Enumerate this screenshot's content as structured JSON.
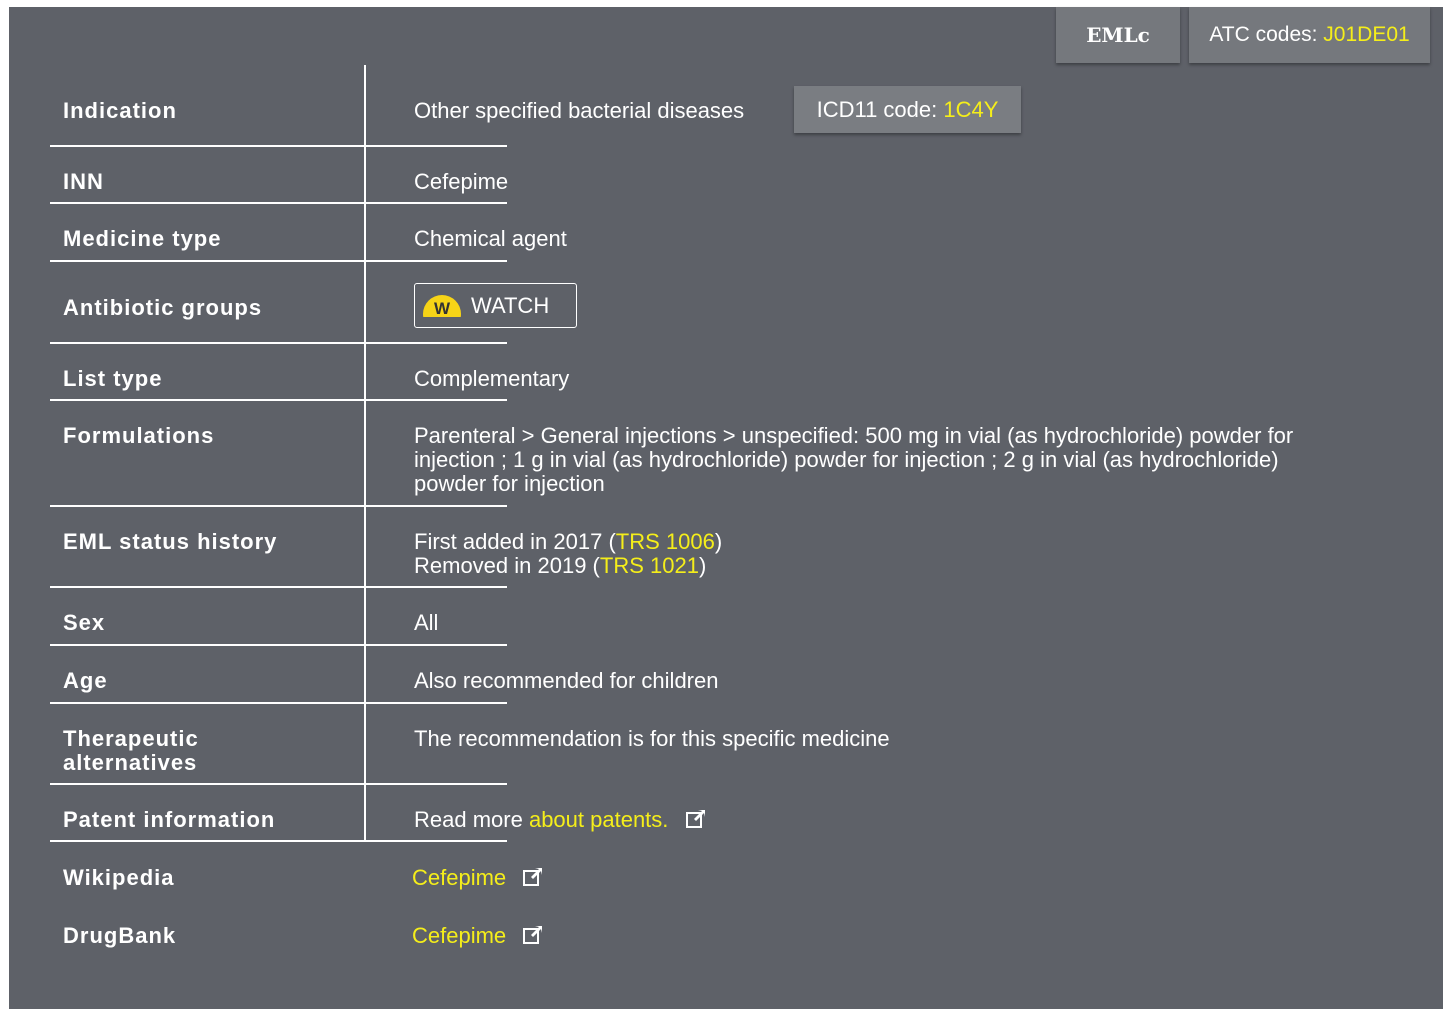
{
  "tabs": {
    "emlc_label": "EMLc",
    "atc_prefix": "ATC codes: ",
    "atc_code": "J01DE01"
  },
  "rows": {
    "indication": {
      "label": "Indication",
      "value": "Other specified bacterial diseases",
      "icd_prefix": "ICD11 code: ",
      "icd_code": "1C4Y"
    },
    "inn": {
      "label": "INN",
      "value": "Cefepime"
    },
    "medicine_type": {
      "label": "Medicine type",
      "value": "Chemical agent"
    },
    "antibiotic_groups": {
      "label": "Antibiotic groups",
      "badge_icon_letter": "W",
      "badge_label": "WATCH"
    },
    "list_type": {
      "label": "List type",
      "value": "Complementary"
    },
    "formulations": {
      "label": "Formulations",
      "lines": [
        "Parenteral > General injections > unspecified: 500 mg in vial (as hydrochloride) powder for",
        "injection ; 1 g in vial (as hydrochloride) powder for injection ; 2 g in vial (as hydrochloride)",
        "powder for injection"
      ]
    },
    "eml_status_history": {
      "label": "EML status history",
      "line1_prefix": "First added in 2017 (",
      "line1_link": "TRS 1006",
      "line1_suffix": ")",
      "line2_prefix": "Removed in 2019 (",
      "line2_link": "TRS 1021",
      "line2_suffix": ")"
    },
    "sex": {
      "label": "Sex",
      "value": "All"
    },
    "age": {
      "label": "Age",
      "value": "Also recommended for children"
    },
    "therapeutic_alternatives": {
      "label_line1": "Therapeutic",
      "label_line2": "alternatives",
      "value": "The recommendation is for this specific medicine"
    },
    "patent_information": {
      "label": "Patent information",
      "prefix": "Read more ",
      "link": "about patents."
    },
    "wikipedia": {
      "label": "Wikipedia",
      "link": "Cefepime"
    },
    "drugbank": {
      "label": "DrugBank",
      "link": "Cefepime"
    }
  },
  "colors": {
    "panel_bg": "#5e6168",
    "link": "#f5ee1a",
    "watch_icon": "#f7d417"
  },
  "icons": {
    "external_link": "external-link-icon"
  }
}
